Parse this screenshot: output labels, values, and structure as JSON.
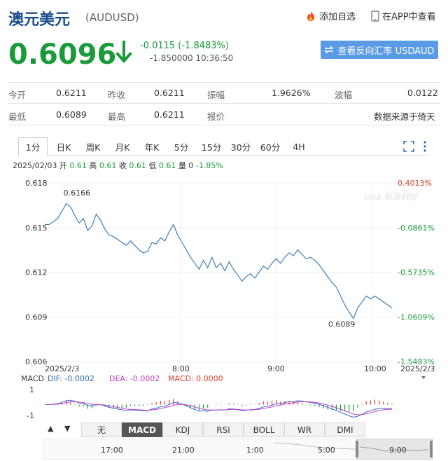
{
  "header": {
    "title": "澳元美元",
    "symbol": "(AUDUSD)",
    "favorite_label": "添加自选",
    "app_label": "在APP中查看"
  },
  "quote": {
    "price": "0.6096",
    "change": "-0.0115 (-1.8483%)",
    "detail": "-1.850000 10:36:50",
    "reverse_button": "查看反向汇率 USDAUD"
  },
  "stats": {
    "row1": [
      {
        "label": "今开",
        "value": "0.6211"
      },
      {
        "label": "昨收",
        "value": "0.6211"
      },
      {
        "label": "振幅",
        "value": "1.9626%"
      },
      {
        "label": "波幅",
        "value": "0.0122"
      }
    ],
    "row2": [
      {
        "label": "最低",
        "value": "0.6089"
      },
      {
        "label": "最高",
        "value": "0.6211"
      },
      {
        "label": "报价",
        "value": "数据来源于倚天"
      }
    ]
  },
  "period_tabs": [
    "1分",
    "日K",
    "周K",
    "月K",
    "年K",
    "5分",
    "15分",
    "30分",
    "60分",
    "4H"
  ],
  "active_period": "1分",
  "ohlc": {
    "date": "2025/02/03",
    "open_label": "开",
    "open": "0.61",
    "high_label": "高",
    "high": "0.61",
    "close_label": "收",
    "close": "0.61",
    "low_label": "低",
    "low": "0.61",
    "vol_label": "量",
    "vol": "0",
    "pct": "-1.85%"
  },
  "chart_data": {
    "type": "line",
    "y_ticks": [
      "0.618",
      "0.615",
      "0.612",
      "0.609",
      "0.606"
    ],
    "pct_ticks": [
      "0.4013%",
      "-0.0861%",
      "-0.5735%",
      "-1.0609%",
      "-1.5483%"
    ],
    "x_ticks": [
      "2025/2/3",
      "8:00",
      "9:00",
      "10:00",
      "2025/2/3"
    ],
    "ylim": [
      0.606,
      0.618
    ],
    "annotations": [
      "0.6166",
      "0.6089"
    ],
    "values": [
      0.6152,
      0.6152,
      0.6154,
      0.6156,
      0.6161,
      0.6166,
      0.6164,
      0.6158,
      0.6153,
      0.6156,
      0.6148,
      0.6151,
      0.6159,
      0.6155,
      0.6149,
      0.6145,
      0.6144,
      0.6142,
      0.614,
      0.6138,
      0.6141,
      0.6138,
      0.6135,
      0.6133,
      0.6134,
      0.614,
      0.6139,
      0.6143,
      0.6141,
      0.6147,
      0.6152,
      0.6145,
      0.614,
      0.6135,
      0.613,
      0.6126,
      0.6122,
      0.6128,
      0.6123,
      0.613,
      0.6123,
      0.6126,
      0.6121,
      0.6127,
      0.6122,
      0.6118,
      0.6114,
      0.6117,
      0.6119,
      0.6116,
      0.612,
      0.6124,
      0.6122,
      0.6126,
      0.6129,
      0.6126,
      0.613,
      0.6133,
      0.6131,
      0.6135,
      0.6132,
      0.6129,
      0.613,
      0.6128,
      0.6125,
      0.6121,
      0.6117,
      0.6113,
      0.611,
      0.6104,
      0.6098,
      0.6093,
      0.6089,
      0.6096,
      0.61,
      0.6104,
      0.6102,
      0.6104,
      0.6102,
      0.61,
      0.6098,
      0.6096
    ],
    "macd_label": "MACD",
    "dif_label": "DIF: -0.0002",
    "dea_label": "DEA: -0.0002",
    "macd_value": "MACD: 0.0000",
    "macd_axis": [
      "1",
      "-1"
    ]
  },
  "indicators": [
    "无",
    "MACD",
    "KDJ",
    "RSI",
    "BOLL",
    "WR",
    "DMI"
  ],
  "active_indicator": "MACD",
  "nav_times": [
    "17:00",
    "21:00",
    "1:00",
    "5:00",
    "9:00"
  ],
  "watermark": "sina 新浪财经",
  "colors": {
    "up": "#d9412b",
    "down": "#1a9a3a",
    "line": "#3e7fb8",
    "accent": "#5a9be6"
  }
}
